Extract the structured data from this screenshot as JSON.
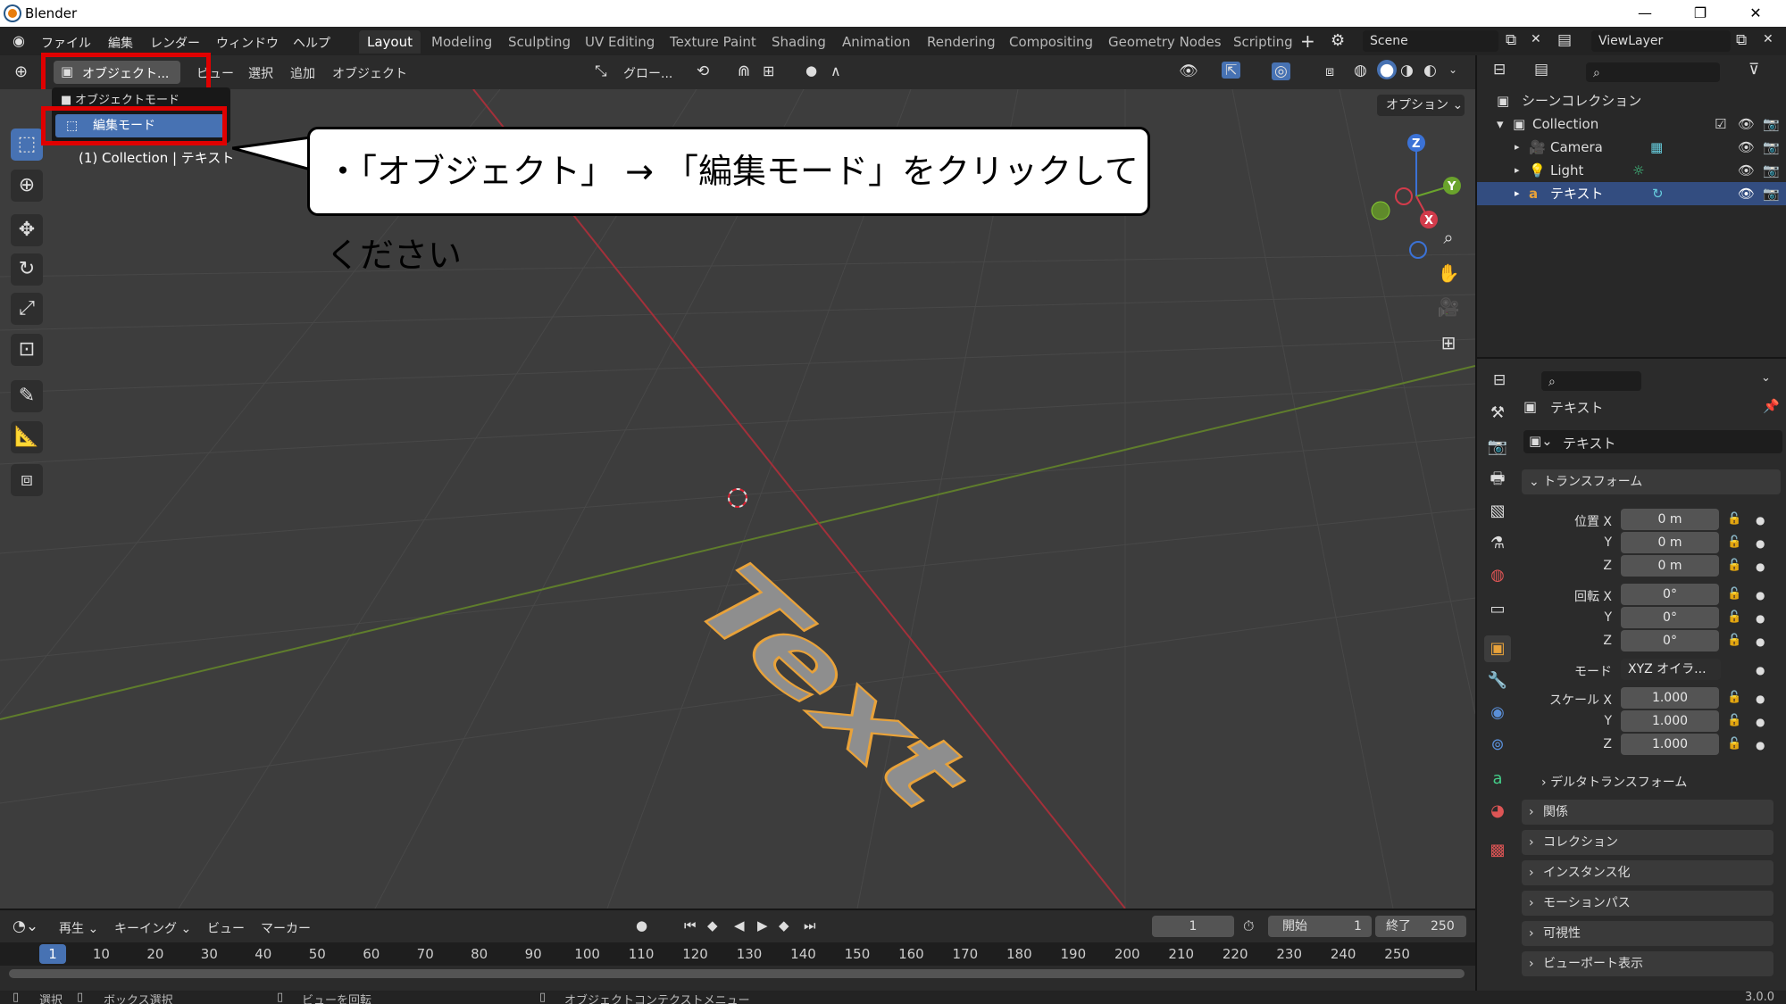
{
  "window": {
    "title": "Blender",
    "minimize": "—",
    "maximize": "❐",
    "close": "✕"
  },
  "menus": [
    "ファイル",
    "編集",
    "レンダー",
    "ウィンドウ",
    "ヘルプ"
  ],
  "workspaces": [
    "Layout",
    "Modeling",
    "Sculpting",
    "UV Editing",
    "Texture Paint",
    "Shading",
    "Animation",
    "Rendering",
    "Compositing",
    "Geometry Nodes",
    "Scripting"
  ],
  "workspace_active": "Layout",
  "scene": "Scene",
  "view_layer": "ViewLayer",
  "header": {
    "mode": "オブジェクト...",
    "view": "ビュー",
    "select": "選択",
    "add": "追加",
    "object": "オブジェクト",
    "transform": "グロー...",
    "options": "オプション"
  },
  "mode_dropdown": {
    "items": [
      "オブジェクトモード",
      "編集モード"
    ],
    "highlighted": "編集モード"
  },
  "viewport": {
    "info": "(1) Collection | テキスト",
    "text_object": "Text"
  },
  "gizmo": {
    "z": "Z",
    "y": "Y",
    "x": "X"
  },
  "callout": "・「オブジェクト」 → 「編集モード」をクリックしてください",
  "outliner": {
    "scene_collection": "シーンコレクション",
    "collection": "Collection",
    "items": [
      "Camera",
      "Light",
      "テキスト"
    ]
  },
  "properties": {
    "object_name": "テキスト",
    "data_name": "テキスト",
    "transform_header": "トランスフォーム",
    "location": {
      "label": "位置 X",
      "x": "0 m",
      "y": "0 m",
      "z": "0 m"
    },
    "rotation": {
      "label": "回転 X",
      "x": "0°",
      "y": "0°",
      "z": "0°"
    },
    "mode_label": "モード",
    "mode_value": "XYZ オイラ...",
    "scale": {
      "label": "スケール X",
      "x": "1.000",
      "y": "1.000",
      "z": "1.000"
    },
    "axis_y": "Y",
    "axis_z": "Z",
    "delta": "デルタトランスフォーム",
    "panels": [
      "関係",
      "コレクション",
      "インスタンス化",
      "モーションパス",
      "可視性",
      "ビューポート表示"
    ]
  },
  "timeline": {
    "playback": "再生",
    "keying": "キーイング",
    "view": "ビュー",
    "marker": "マーカー",
    "current_frame": "1",
    "start_label": "開始",
    "start": "1",
    "end_label": "終了",
    "end": "250",
    "ticks": [
      "1",
      "10",
      "20",
      "30",
      "40",
      "50",
      "60",
      "70",
      "80",
      "90",
      "100",
      "110",
      "120",
      "130",
      "140",
      "150",
      "160",
      "170",
      "180",
      "190",
      "200",
      "210",
      "220",
      "230",
      "240",
      "250"
    ]
  },
  "statusbar": {
    "select": "選択",
    "box_select": "ボックス選択",
    "rotate_view": "ビューを回転",
    "context_menu": "オブジェクトコンテクストメニュー",
    "version": "3.0.0"
  },
  "colors": {
    "accent": "#4772b3",
    "highlight_red": "#e00000",
    "object_orange": "#e8a23a",
    "x_axis": "#c0392b",
    "y_axis": "#6f9a2c"
  }
}
